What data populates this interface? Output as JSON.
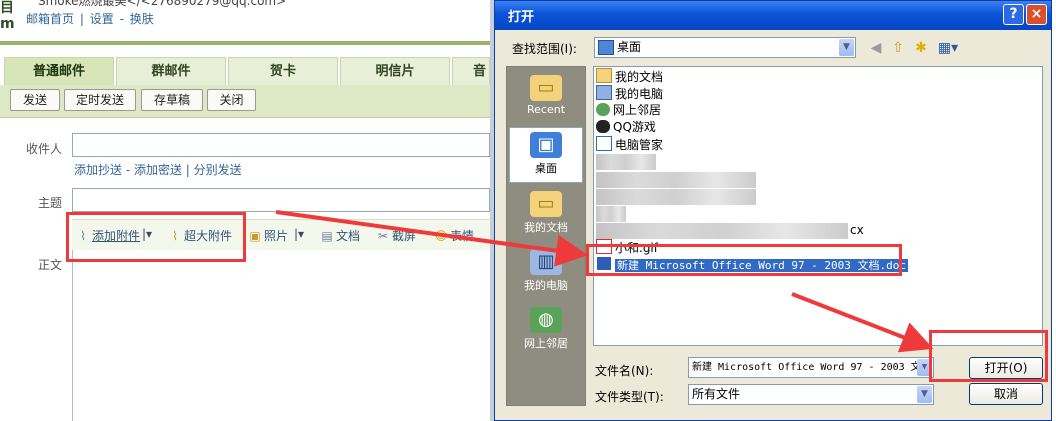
{
  "mail": {
    "logo_glyph": "目\nm",
    "user_line": "Smoke燃烧最美</<276890279@qq.com>",
    "top_links": [
      "邮箱首页",
      "|",
      "设置",
      "-",
      "换肤"
    ],
    "tabs": [
      {
        "label": "普通邮件",
        "active": true
      },
      {
        "label": "群邮件"
      },
      {
        "label": "贺卡"
      },
      {
        "label": "明信片"
      },
      {
        "label": "音"
      }
    ],
    "toolbar": {
      "send": "发送",
      "scheduled": "定时发送",
      "draft": "存草稿",
      "close": "关闭"
    },
    "recipient_label": "收件人",
    "cc_links": "添加抄送 - 添加密送 | 分别发送",
    "subject_label": "主题",
    "attach_bar": {
      "add_attachment": "添加附件",
      "large_attachment": "超大附件",
      "photo": "照片",
      "document": "文档",
      "screenshot": "截屏",
      "emoji": "表情"
    },
    "body_label": "正文"
  },
  "dialog": {
    "title": "打开",
    "help": "?",
    "close": "×",
    "lookin_label": "查找范围(I):",
    "lookin_value": "桌面",
    "places": [
      {
        "label": "Recent"
      },
      {
        "label": "桌面",
        "selected": true
      },
      {
        "label": "我的文档"
      },
      {
        "label": "我的电脑"
      },
      {
        "label": "网上邻居"
      }
    ],
    "files": [
      {
        "name": "我的文档"
      },
      {
        "name": "我的电脑"
      },
      {
        "name": "网上邻居"
      },
      {
        "name": "QQ游戏"
      },
      {
        "name": "电脑管家"
      }
    ],
    "partial_files": [
      {
        "name": "cx"
      },
      {
        "name": "小和.gif"
      }
    ],
    "selected_file": "新建 Microsoft Office Word 97 - 2003 文档.doc",
    "filename_label": "文件名(N):",
    "filename_value": "新建 Microsoft Office Word 97 - 2003 文",
    "filetype_label": "文件类型(T):",
    "filetype_value": "所有文件",
    "open_button": "打开(O)",
    "cancel_button": "取消"
  },
  "colors": {
    "annotation": "#ee3a3a",
    "title_bar": "#0a53d8",
    "selection": "#316ac5",
    "mail_green": "#9bb36a"
  }
}
